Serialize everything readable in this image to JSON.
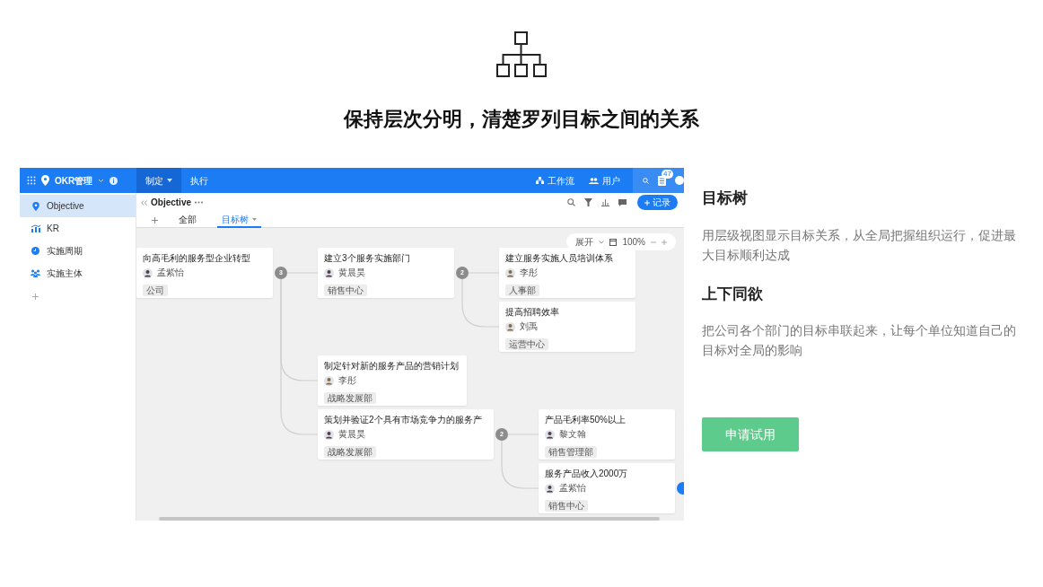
{
  "header": {
    "headline": "保持层次分明，清楚罗列目标之间的关系"
  },
  "app": {
    "topbar": {
      "app_name": "OKR管理",
      "menus": [
        {
          "label": "制定",
          "selected": true
        },
        {
          "label": "执行",
          "selected": false
        }
      ],
      "links": [
        {
          "label": "工作流",
          "kind": "flow"
        },
        {
          "label": "用户",
          "kind": "users"
        }
      ],
      "notification_count": "47"
    },
    "sidebar": {
      "items": [
        {
          "label": "Objective",
          "kind": "pin",
          "selected": true
        },
        {
          "label": "KR",
          "kind": "chart",
          "selected": false
        },
        {
          "label": "实施周期",
          "kind": "clock",
          "selected": false
        },
        {
          "label": "实施主体",
          "kind": "team",
          "selected": false
        }
      ]
    },
    "view": {
      "title": "Objective",
      "tabs": [
        {
          "label": "全部",
          "selected": false
        },
        {
          "label": "目标树",
          "selected": true
        }
      ],
      "add_button": "记录"
    },
    "zoom_bar": {
      "expand": "展开",
      "zoom": "100%"
    },
    "tree": {
      "nodes": [
        {
          "title": "向高毛利的服务型企业转型",
          "owner": "孟紫怡",
          "department": "公司",
          "badge": "3",
          "children": [
            {
              "title": "建立3个服务实施部门",
              "owner": "黄晨昊",
              "department": "销售中心",
              "badge": "2",
              "children": [
                {
                  "title": "建立服务实施人员培训体系",
                  "owner": "李彤",
                  "department": "人事部"
                },
                {
                  "title": "提高招聘效率",
                  "owner": "刘禹",
                  "department": "运营中心"
                }
              ]
            },
            {
              "title": "制定针对新的服务产品的营销计划",
              "owner": "李彤",
              "department": "战略发展部"
            },
            {
              "title": "策划并验证2个具有市场竞争力的服务产",
              "owner": "黄晨昊",
              "department": "战略发展部",
              "badge": "2",
              "children": [
                {
                  "title": "产品毛利率50%以上",
                  "owner": "黎文翰",
                  "department": "销售管理部"
                },
                {
                  "title": "服务产品收入2000万",
                  "owner": "孟紫怡",
                  "department": "销售中心"
                }
              ]
            }
          ]
        }
      ]
    }
  },
  "features": [
    {
      "title": "目标树",
      "text": "用层级视图显示目标关系，从全局把握组织运行，促进最大目标顺利达成"
    },
    {
      "title": "上下同欲",
      "text": "把公司各个部门的目标串联起来，让每个单位知道自己的目标对全局的影响"
    }
  ],
  "cta": {
    "label": "申请试用"
  }
}
